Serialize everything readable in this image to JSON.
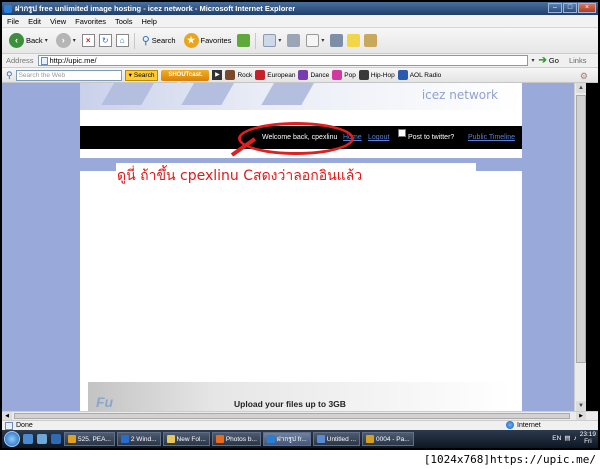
{
  "window": {
    "title": "ฝากรูป free unlimited image hosting - icez network - Microsoft Internet Explorer",
    "min_glyph": "–",
    "max_glyph": "□",
    "close_glyph": "×"
  },
  "menu": [
    "File",
    "Edit",
    "View",
    "Favorites",
    "Tools",
    "Help"
  ],
  "toolbar": {
    "back_label": "Back",
    "search_label": "Search",
    "favorites_label": "Favorites"
  },
  "address": {
    "label": "Address",
    "url": "http://upic.me/",
    "go_label": "Go",
    "links_label": "Links"
  },
  "search_toolbar": {
    "placeholder": "Search the Web",
    "search_btn": "Search",
    "radio_logo": "SHOUTcast. Radio",
    "genres": [
      "Rock",
      "European",
      "Dance",
      "Pop",
      "Hip-Hop",
      "AOL Radio"
    ]
  },
  "page": {
    "brand": "icez network",
    "welcome": "Welcome back, cpexlinu",
    "home_link": "Home",
    "logout_link": "Logout",
    "post_twitter": "Post to twitter?",
    "public_timeline": "Public Timeline",
    "annotation": "ดูนี่ ถ้าขึ้น cpexlinu  Cสดงว่าลอกอินแล้ว",
    "upload_logo": "Fu",
    "upload_text": "Upload your files up to 3GB"
  },
  "status": {
    "text": "Done",
    "zone": "Internet"
  },
  "taskbar": {
    "tasks": [
      {
        "label": "525. PEA...",
        "color": "#e0a020"
      },
      {
        "label": "2 Wind...",
        "color": "#2a6cc9"
      },
      {
        "label": "New Fol...",
        "color": "#e8c75a"
      },
      {
        "label": "Photos b...",
        "color": "#e86a1a"
      },
      {
        "label": "ฝากรูป fr...",
        "color": "#2a7fd4"
      },
      {
        "label": "Untitled ...",
        "color": "#5a8ad0"
      },
      {
        "label": "0004 - Pa...",
        "color": "#d4a020"
      }
    ],
    "lang": "EN",
    "time": "23:19",
    "day": "Fri"
  },
  "caption": "[1024x768]https://upic.me/"
}
